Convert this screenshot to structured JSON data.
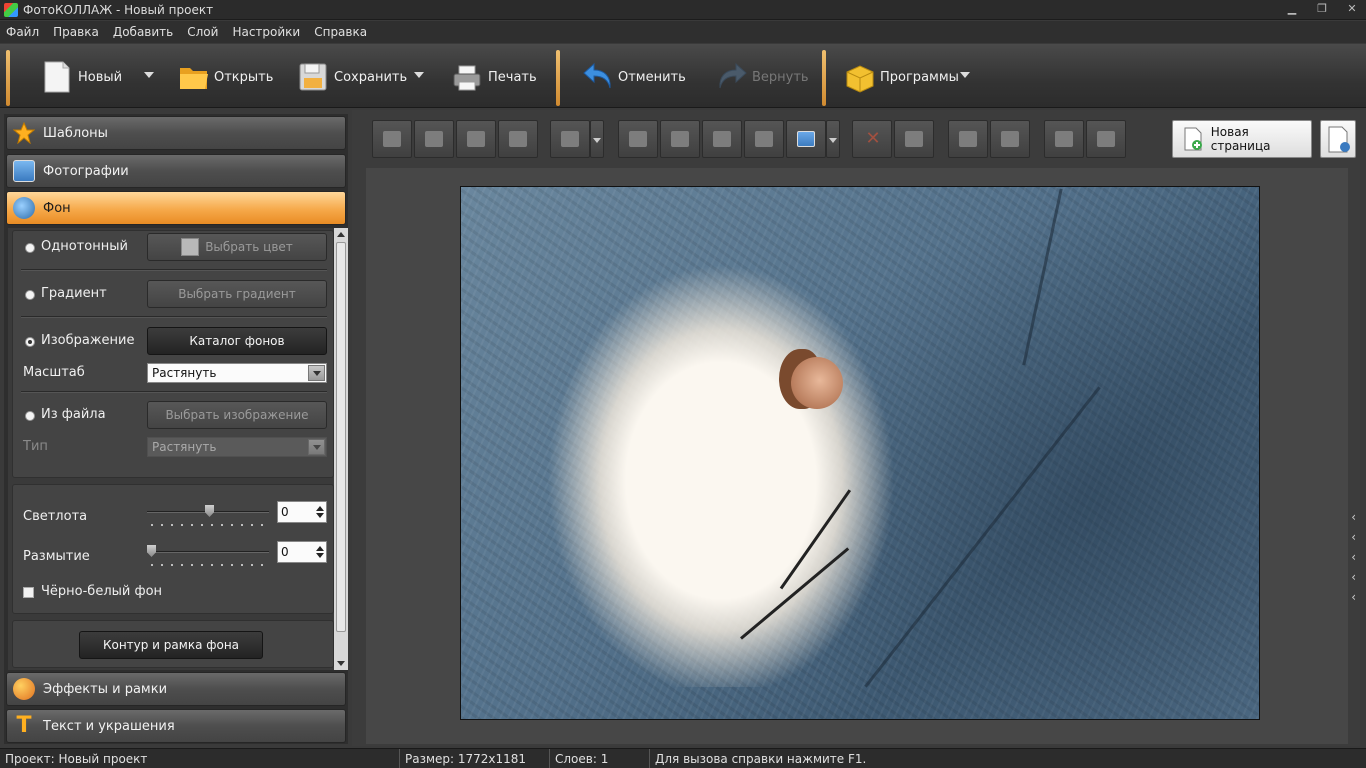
{
  "window": {
    "title": "ФотоКОЛЛАЖ - Новый проект"
  },
  "menu": [
    "Файл",
    "Правка",
    "Добавить",
    "Слой",
    "Настройки",
    "Справка"
  ],
  "toolbar": {
    "new_label": "Новый",
    "open_label": "Открыть",
    "save_label": "Сохранить",
    "print_label": "Печать",
    "undo_label": "Отменить",
    "redo_label": "Вернуть",
    "programs_label": "Программы"
  },
  "panels": {
    "templates": "Шаблоны",
    "photos": "Фотографии",
    "background": "Фон",
    "effects": "Эффекты и рамки",
    "text": "Текст и украшения"
  },
  "background": {
    "solid_label": "Однотонный",
    "choose_color": "Выбрать цвет",
    "gradient_label": "Градиент",
    "choose_gradient": "Выбрать градиент",
    "image_label": "Изображение",
    "catalog_button": "Каталог фонов",
    "scale_label": "Масштаб",
    "scale_value": "Растянуть",
    "file_label": "Из файла",
    "choose_image": "Выбрать изображение",
    "type_label": "Тип",
    "type_value": "Растянуть",
    "brightness_label": "Светлота",
    "brightness_value": "0",
    "blur_label": "Размытие",
    "blur_value": "0",
    "bw_label": "Чёрно-белый фон",
    "outline_button": "Контур и рамка фона",
    "selected_mode": "image"
  },
  "editor": {
    "new_page_label": "Новая страница"
  },
  "statusbar": {
    "project": "Проект:  Новый проект",
    "size": "Размер:  1772x1181",
    "layers": "Слоев:  1",
    "hint": "Для вызова справки нажмите F1."
  },
  "colors": {
    "accent": "#f6a94a",
    "panel": "#3a3a3a",
    "toolbar": "#333333"
  }
}
